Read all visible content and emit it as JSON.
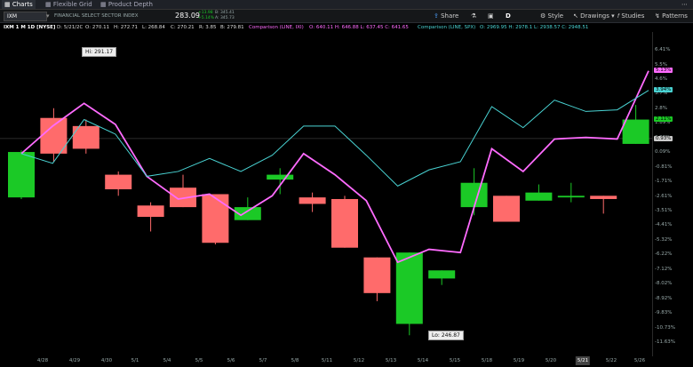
{
  "tabs": [
    {
      "label": "Charts",
      "active": true
    },
    {
      "label": "Flexible Grid",
      "active": false
    },
    {
      "label": "Product Depth",
      "active": false
    }
  ],
  "toolbar": {
    "symbol": "IXM",
    "description": "FINANCIAL SELECT SECTOR INDEX",
    "price": "283.09",
    "change_abs": "+13.98",
    "change_pct": "+5.14%",
    "bid": "B: 345.41",
    "ask": "A: 345.73",
    "share_label": "Share",
    "period_label": "D",
    "style_label": "Style",
    "drawings_label": "Drawings",
    "studies_label": "Studies",
    "patterns_label": "Patterns"
  },
  "legend": {
    "title": "IXM 1 M 1D [NYSE]",
    "date": "D: 5/21/2C",
    "open": "O: 270.11",
    "high": "H: 272.71",
    "low": "L: 268.84",
    "close": "C: 270.21",
    "range": "R: 3.85",
    "extra": "B: 279.81",
    "comp1_name": "Comparison (LINE, IXI)",
    "comp1_values": "O: 640.11  H: 646.88  L: 637.45  C: 641.65",
    "comp2_name": "Comparison (LINE, SPX)",
    "comp2_values": "O: 2969.95  H: 2978.1  L: 2938.57  C: 2948.51"
  },
  "callouts": {
    "hi": "Hi: 291.17",
    "lo": "Lo: 246.87"
  },
  "colors": {
    "up": "#1bc926",
    "down": "#ff6b6b",
    "magenta": "#ff6bff",
    "cyan": "#49d3d3",
    "background": "#000000"
  },
  "chart_data": {
    "type": "candlestick",
    "ylim": [
      -12.5,
      7.5
    ],
    "y_ticks": [
      "6.41%",
      "5.5%",
      "4.6%",
      "3.7%",
      "2.8%",
      "1.89%",
      "0.99%",
      "0.09%",
      "-0.81%",
      "-1.71%",
      "-2.61%",
      "-3.51%",
      "-4.41%",
      "-5.32%",
      "-6.22%",
      "-7.12%",
      "-8.02%",
      "-8.92%",
      "-9.83%",
      "-10.73%",
      "-11.63%"
    ],
    "y_badges": [
      {
        "label": "5.13%",
        "value": 5.13,
        "color": "#ff6bff"
      },
      {
        "label": "3.94%",
        "value": 3.94,
        "color": "#49d3d3"
      },
      {
        "label": "2.11%",
        "value": 2.11,
        "color": "#1bc926"
      },
      {
        "label": "0.93%",
        "value": 0.93,
        "color": "#cccccc"
      }
    ],
    "x_labels": [
      "4/28",
      "4/29",
      "4/30",
      "5/1",
      "5/4",
      "5/5",
      "5/6",
      "5/7",
      "5/8",
      "5/11",
      "5/12",
      "5/13",
      "5/14",
      "5/15",
      "5/18",
      "5/19",
      "5/20",
      "5/21",
      "5/22",
      "5/26"
    ],
    "candles": [
      {
        "o": -2.7,
        "c": 0.1,
        "h": 0.2,
        "l": -2.8
      },
      {
        "o": 2.2,
        "c": 0.0,
        "h": 2.8,
        "l": -0.5
      },
      {
        "o": 1.7,
        "c": 0.3,
        "h": 2.1,
        "l": 0.0
      },
      {
        "o": -1.3,
        "c": -2.2,
        "h": -1.1,
        "l": -2.6
      },
      {
        "o": -3.2,
        "c": -3.9,
        "h": -3.0,
        "l": -4.8
      },
      {
        "o": -2.1,
        "c": -3.3,
        "h": -1.3,
        "l": -3.3
      },
      {
        "o": -2.5,
        "c": -5.5,
        "h": -2.5,
        "l": -5.6
      },
      {
        "o": -4.1,
        "c": -3.3,
        "h": -2.7,
        "l": -4.1
      },
      {
        "o": -1.6,
        "c": -1.3,
        "h": -0.9,
        "l": -2.5
      },
      {
        "o": -2.7,
        "c": -3.1,
        "h": -2.4,
        "l": -3.6
      },
      {
        "o": -2.8,
        "c": -5.8,
        "h": -2.6,
        "l": -5.8
      },
      {
        "o": -6.4,
        "c": -8.6,
        "h": -6.4,
        "l": -9.1
      },
      {
        "o": -10.5,
        "c": -6.1,
        "h": -6.1,
        "l": -11.2
      },
      {
        "o": -7.7,
        "c": -7.2,
        "h": -7.2,
        "l": -8.1
      },
      {
        "o": -3.3,
        "c": -1.8,
        "h": -0.9,
        "l": -3.8
      },
      {
        "o": -2.6,
        "c": -4.2,
        "h": -2.6,
        "l": -4.2
      },
      {
        "o": -2.9,
        "c": -2.4,
        "h": -1.9,
        "l": -2.9
      },
      {
        "o": -2.7,
        "c": -2.6,
        "h": -1.8,
        "l": -3.0
      },
      {
        "o": -2.6,
        "c": -2.8,
        "h": -2.6,
        "l": -3.7
      },
      {
        "o": 0.6,
        "c": 2.1,
        "h": 3.0,
        "l": 0.6
      }
    ],
    "series": [
      {
        "name": "Comparison (LINE, IXI)",
        "color": "#ff6bff",
        "values": [
          0.0,
          1.7,
          3.1,
          1.8,
          -1.4,
          -2.8,
          -2.5,
          -3.8,
          -2.6,
          0.0,
          -1.3,
          -2.9,
          -6.7,
          -5.9,
          -6.1,
          0.3,
          -1.1,
          0.9,
          1.0,
          0.9,
          5.1
        ]
      },
      {
        "name": "Comparison (LINE, SPX)",
        "color": "#49d3d3",
        "values": [
          0.0,
          -0.6,
          2.1,
          1.2,
          -1.4,
          -1.1,
          -0.3,
          -1.1,
          -0.1,
          1.7,
          1.7,
          -0.1,
          -2.0,
          -1.0,
          -0.5,
          2.9,
          1.6,
          3.3,
          2.6,
          2.7,
          3.9
        ]
      }
    ]
  }
}
